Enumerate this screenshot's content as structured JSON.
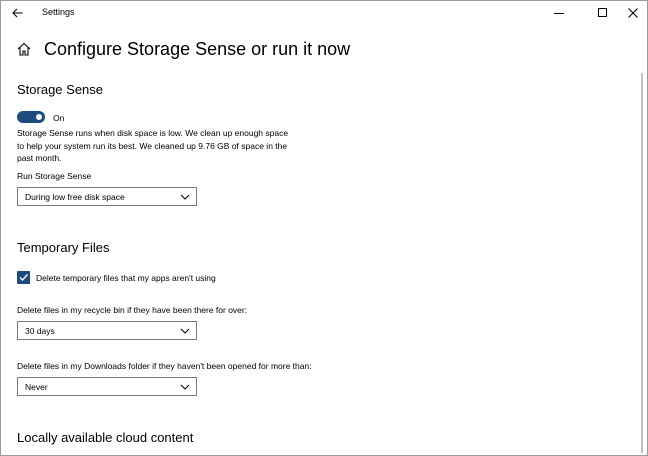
{
  "window": {
    "title": "Settings"
  },
  "page": {
    "title": "Configure Storage Sense or run it now"
  },
  "storage_sense": {
    "heading": "Storage Sense",
    "toggle_state": "On",
    "toggle_on": true,
    "description_lines": [
      "Storage Sense runs when disk space is low. We clean up enough space",
      "to help your system run its best. We cleaned up 9.76 GB of space in the",
      "past month."
    ],
    "run_label": "Run Storage Sense",
    "run_value": "During low free disk space"
  },
  "temporary_files": {
    "heading": "Temporary Files",
    "checkbox_label": "Delete temporary files that my apps aren't using",
    "checkbox_checked": true,
    "recycle_label": "Delete files in my recycle bin if they have been there for over:",
    "recycle_value": "30 days",
    "downloads_label": "Delete files in my Downloads folder if they haven't been opened for more than:",
    "downloads_value": "Never"
  },
  "cloud": {
    "heading": "Locally available cloud content"
  },
  "colors": {
    "accent": "#1e4b80",
    "border": "#7a7a7a"
  },
  "icons": {
    "back": "back-arrow-icon",
    "home": "home-icon",
    "minimize": "minimize-icon",
    "maximize": "maximize-icon",
    "close": "close-icon",
    "chevron": "chevron-down-icon",
    "check": "checkmark-icon"
  }
}
